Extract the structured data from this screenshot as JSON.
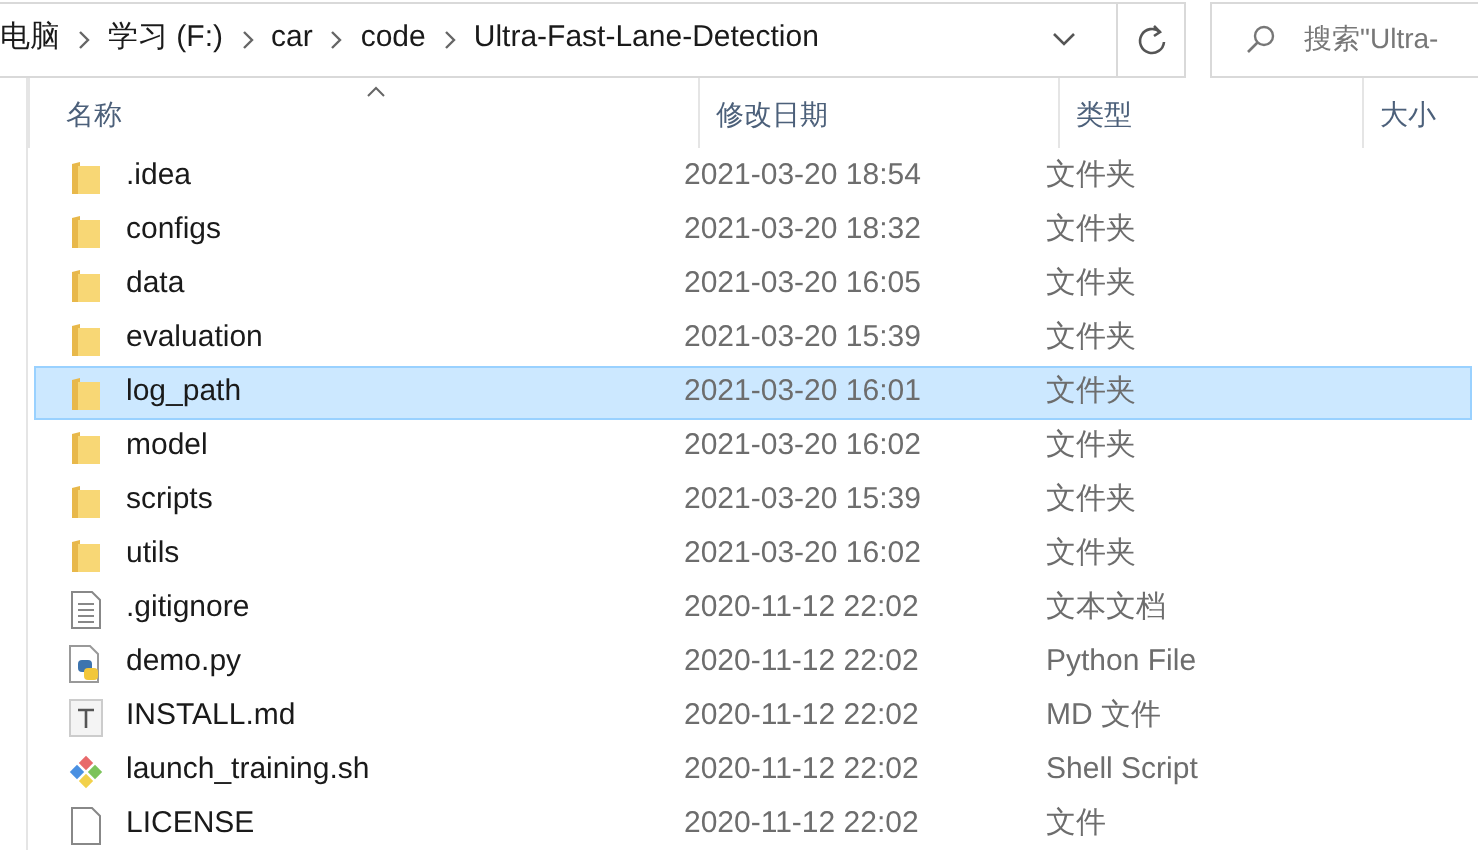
{
  "address_bar": {
    "crumbs": [
      "电脑",
      "学习 (F:)",
      "car",
      "code",
      "Ultra-Fast-Lane-Detection"
    ]
  },
  "search": {
    "placeholder": "搜索\"Ultra-"
  },
  "table": {
    "columns": [
      "名称",
      "修改日期",
      "类型",
      "大小"
    ],
    "rows": [
      {
        "name": ".idea",
        "date": "2021-03-20 18:54",
        "type": "文件夹",
        "kind": "folder",
        "selected": false
      },
      {
        "name": "configs",
        "date": "2021-03-20 18:32",
        "type": "文件夹",
        "kind": "folder",
        "selected": false
      },
      {
        "name": "data",
        "date": "2021-03-20 16:05",
        "type": "文件夹",
        "kind": "folder",
        "selected": false
      },
      {
        "name": "evaluation",
        "date": "2021-03-20 15:39",
        "type": "文件夹",
        "kind": "folder",
        "selected": false
      },
      {
        "name": "log_path",
        "date": "2021-03-20 16:01",
        "type": "文件夹",
        "kind": "folder",
        "selected": true
      },
      {
        "name": "model",
        "date": "2021-03-20 16:02",
        "type": "文件夹",
        "kind": "folder",
        "selected": false
      },
      {
        "name": "scripts",
        "date": "2021-03-20 15:39",
        "type": "文件夹",
        "kind": "folder",
        "selected": false
      },
      {
        "name": "utils",
        "date": "2021-03-20 16:02",
        "type": "文件夹",
        "kind": "folder",
        "selected": false
      },
      {
        "name": ".gitignore",
        "date": "2020-11-12 22:02",
        "type": "文本文档",
        "kind": "text",
        "selected": false
      },
      {
        "name": "demo.py",
        "date": "2020-11-12 22:02",
        "type": "Python File",
        "kind": "python",
        "selected": false
      },
      {
        "name": "INSTALL.md",
        "date": "2020-11-12 22:02",
        "type": "MD 文件",
        "kind": "markdown",
        "selected": false
      },
      {
        "name": "launch_training.sh",
        "date": "2020-11-12 22:02",
        "type": "Shell Script",
        "kind": "shell",
        "selected": false
      },
      {
        "name": "LICENSE",
        "date": "2020-11-12 22:02",
        "type": "文件",
        "kind": "file",
        "selected": false
      }
    ]
  }
}
